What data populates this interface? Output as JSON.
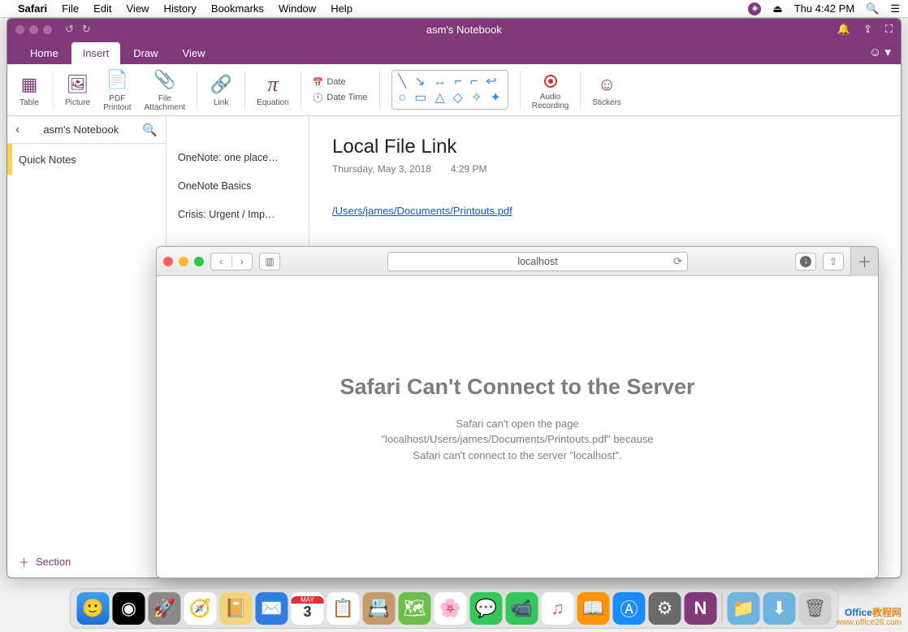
{
  "menubar": {
    "app": "Safari",
    "items": [
      "File",
      "Edit",
      "View",
      "History",
      "Bookmarks",
      "Window",
      "Help"
    ],
    "clock": "Thu 4:42 PM"
  },
  "onenote": {
    "window_title": "asm's Notebook",
    "tabs": [
      "Home",
      "Insert",
      "Draw",
      "View"
    ],
    "active_tab": "Insert",
    "ribbon": {
      "table": "Table",
      "picture": "Picture",
      "pdf": "PDF\nPrintout",
      "file": "File\nAttachment",
      "link": "Link",
      "equation": "Equation",
      "date": "Date",
      "datetime": "Date Time",
      "audio": "Audio\nRecording",
      "stickers": "Stickers"
    },
    "notebook": {
      "title": "asm's Notebook",
      "section": "Quick Notes",
      "add_section": "Section",
      "pages": [
        "OneNote: one place…",
        "OneNote Basics",
        "Crisis: Urgent / Imp…"
      ]
    },
    "page": {
      "title": "Local File Link",
      "date": "Thursday, May 3, 2018",
      "time": "4:29 PM",
      "link": "/Users/james/Documents/Printouts.pdf"
    }
  },
  "safari": {
    "address": "localhost",
    "heading": "Safari Can't Connect to the Server",
    "body1": "Safari can't open the page",
    "body2": "\"localhost/Users/james/Documents/Printouts.pdf\" because",
    "body3": "Safari can't connect to the server \"localhost\"."
  },
  "watermark": {
    "brand1": "Office",
    "brand2": "教程网",
    "url": "www.office26.com"
  },
  "dock": {
    "calendar_day": "3"
  }
}
